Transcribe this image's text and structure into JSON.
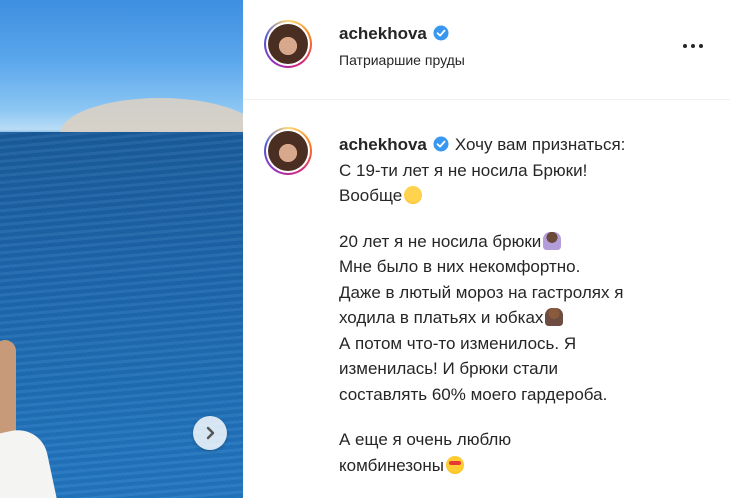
{
  "post": {
    "username": "achekhova",
    "location": "Патриаршие пруды",
    "caption_lines": [
      "Хочу вам признаться:",
      "С 19-ти лет я не носила Брюки!",
      "Вообще",
      "",
      "20 лет я не носила брюки",
      "Мне было в них некомфортно.",
      "Даже в лютый мороз на гастролях я",
      "ходила в платьях и юбках",
      "А потом что-то изменилось. Я",
      "изменилась! И брюки стали",
      "составлять 60% моего гардероба.",
      "",
      "А еще я очень люблю",
      "комбинезоны"
    ]
  },
  "icons": {
    "verified": "verified-badge-icon",
    "more": "more-options-icon",
    "next": "chevron-right-icon"
  },
  "colors": {
    "verified_blue": "#3897f0",
    "text": "#262626"
  }
}
